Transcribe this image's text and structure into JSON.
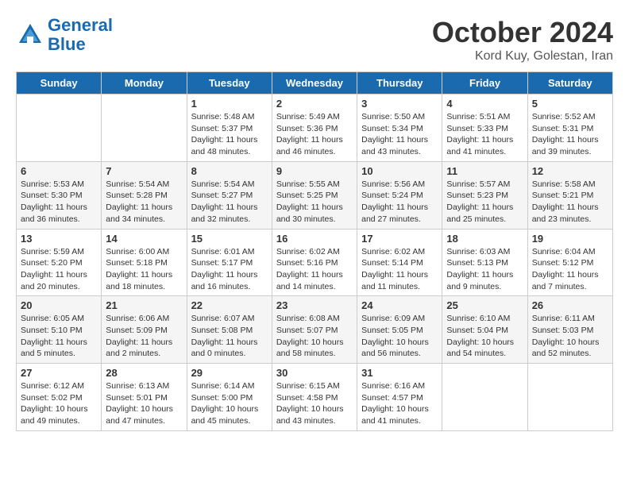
{
  "header": {
    "logo_line1": "General",
    "logo_line2": "Blue",
    "month_title": "October 2024",
    "location": "Kord Kuy, Golestan, Iran"
  },
  "days_of_week": [
    "Sunday",
    "Monday",
    "Tuesday",
    "Wednesday",
    "Thursday",
    "Friday",
    "Saturday"
  ],
  "weeks": [
    [
      {
        "day": "",
        "detail": ""
      },
      {
        "day": "",
        "detail": ""
      },
      {
        "day": "1",
        "detail": "Sunrise: 5:48 AM\nSunset: 5:37 PM\nDaylight: 11 hours and 48 minutes."
      },
      {
        "day": "2",
        "detail": "Sunrise: 5:49 AM\nSunset: 5:36 PM\nDaylight: 11 hours and 46 minutes."
      },
      {
        "day": "3",
        "detail": "Sunrise: 5:50 AM\nSunset: 5:34 PM\nDaylight: 11 hours and 43 minutes."
      },
      {
        "day": "4",
        "detail": "Sunrise: 5:51 AM\nSunset: 5:33 PM\nDaylight: 11 hours and 41 minutes."
      },
      {
        "day": "5",
        "detail": "Sunrise: 5:52 AM\nSunset: 5:31 PM\nDaylight: 11 hours and 39 minutes."
      }
    ],
    [
      {
        "day": "6",
        "detail": "Sunrise: 5:53 AM\nSunset: 5:30 PM\nDaylight: 11 hours and 36 minutes."
      },
      {
        "day": "7",
        "detail": "Sunrise: 5:54 AM\nSunset: 5:28 PM\nDaylight: 11 hours and 34 minutes."
      },
      {
        "day": "8",
        "detail": "Sunrise: 5:54 AM\nSunset: 5:27 PM\nDaylight: 11 hours and 32 minutes."
      },
      {
        "day": "9",
        "detail": "Sunrise: 5:55 AM\nSunset: 5:25 PM\nDaylight: 11 hours and 30 minutes."
      },
      {
        "day": "10",
        "detail": "Sunrise: 5:56 AM\nSunset: 5:24 PM\nDaylight: 11 hours and 27 minutes."
      },
      {
        "day": "11",
        "detail": "Sunrise: 5:57 AM\nSunset: 5:23 PM\nDaylight: 11 hours and 25 minutes."
      },
      {
        "day": "12",
        "detail": "Sunrise: 5:58 AM\nSunset: 5:21 PM\nDaylight: 11 hours and 23 minutes."
      }
    ],
    [
      {
        "day": "13",
        "detail": "Sunrise: 5:59 AM\nSunset: 5:20 PM\nDaylight: 11 hours and 20 minutes."
      },
      {
        "day": "14",
        "detail": "Sunrise: 6:00 AM\nSunset: 5:18 PM\nDaylight: 11 hours and 18 minutes."
      },
      {
        "day": "15",
        "detail": "Sunrise: 6:01 AM\nSunset: 5:17 PM\nDaylight: 11 hours and 16 minutes."
      },
      {
        "day": "16",
        "detail": "Sunrise: 6:02 AM\nSunset: 5:16 PM\nDaylight: 11 hours and 14 minutes."
      },
      {
        "day": "17",
        "detail": "Sunrise: 6:02 AM\nSunset: 5:14 PM\nDaylight: 11 hours and 11 minutes."
      },
      {
        "day": "18",
        "detail": "Sunrise: 6:03 AM\nSunset: 5:13 PM\nDaylight: 11 hours and 9 minutes."
      },
      {
        "day": "19",
        "detail": "Sunrise: 6:04 AM\nSunset: 5:12 PM\nDaylight: 11 hours and 7 minutes."
      }
    ],
    [
      {
        "day": "20",
        "detail": "Sunrise: 6:05 AM\nSunset: 5:10 PM\nDaylight: 11 hours and 5 minutes."
      },
      {
        "day": "21",
        "detail": "Sunrise: 6:06 AM\nSunset: 5:09 PM\nDaylight: 11 hours and 2 minutes."
      },
      {
        "day": "22",
        "detail": "Sunrise: 6:07 AM\nSunset: 5:08 PM\nDaylight: 11 hours and 0 minutes."
      },
      {
        "day": "23",
        "detail": "Sunrise: 6:08 AM\nSunset: 5:07 PM\nDaylight: 10 hours and 58 minutes."
      },
      {
        "day": "24",
        "detail": "Sunrise: 6:09 AM\nSunset: 5:05 PM\nDaylight: 10 hours and 56 minutes."
      },
      {
        "day": "25",
        "detail": "Sunrise: 6:10 AM\nSunset: 5:04 PM\nDaylight: 10 hours and 54 minutes."
      },
      {
        "day": "26",
        "detail": "Sunrise: 6:11 AM\nSunset: 5:03 PM\nDaylight: 10 hours and 52 minutes."
      }
    ],
    [
      {
        "day": "27",
        "detail": "Sunrise: 6:12 AM\nSunset: 5:02 PM\nDaylight: 10 hours and 49 minutes."
      },
      {
        "day": "28",
        "detail": "Sunrise: 6:13 AM\nSunset: 5:01 PM\nDaylight: 10 hours and 47 minutes."
      },
      {
        "day": "29",
        "detail": "Sunrise: 6:14 AM\nSunset: 5:00 PM\nDaylight: 10 hours and 45 minutes."
      },
      {
        "day": "30",
        "detail": "Sunrise: 6:15 AM\nSunset: 4:58 PM\nDaylight: 10 hours and 43 minutes."
      },
      {
        "day": "31",
        "detail": "Sunrise: 6:16 AM\nSunset: 4:57 PM\nDaylight: 10 hours and 41 minutes."
      },
      {
        "day": "",
        "detail": ""
      },
      {
        "day": "",
        "detail": ""
      }
    ]
  ]
}
